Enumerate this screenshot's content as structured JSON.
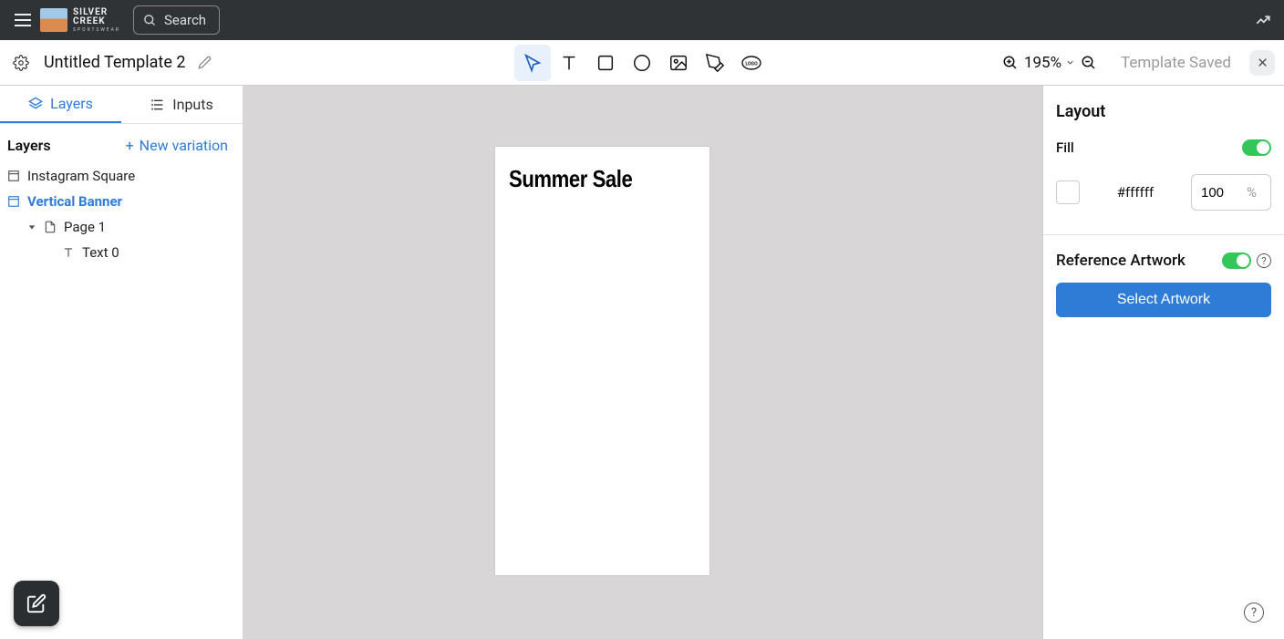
{
  "brand": {
    "line1": "SILVER",
    "line2": "CREEK",
    "sub": "SPORTSWEAR"
  },
  "search": {
    "label": "Search"
  },
  "template": {
    "title": "Untitled Template 2",
    "saved_label": "Template Saved"
  },
  "zoom": {
    "level": "195%"
  },
  "tabs": {
    "layers": "Layers",
    "inputs": "Inputs"
  },
  "layers": {
    "title": "Layers",
    "new_variation": "New variation",
    "items": [
      "Instagram Square",
      "Vertical Banner",
      "Page 1",
      "Text 0"
    ]
  },
  "artboard": {
    "text": "Summer Sale"
  },
  "panel": {
    "layout_title": "Layout",
    "fill_label": "Fill",
    "fill_hex": "#ffffff",
    "fill_opacity": "100",
    "opacity_unit": "%",
    "ref_art_label": "Reference Artwork",
    "select_artwork": "Select Artwork"
  }
}
